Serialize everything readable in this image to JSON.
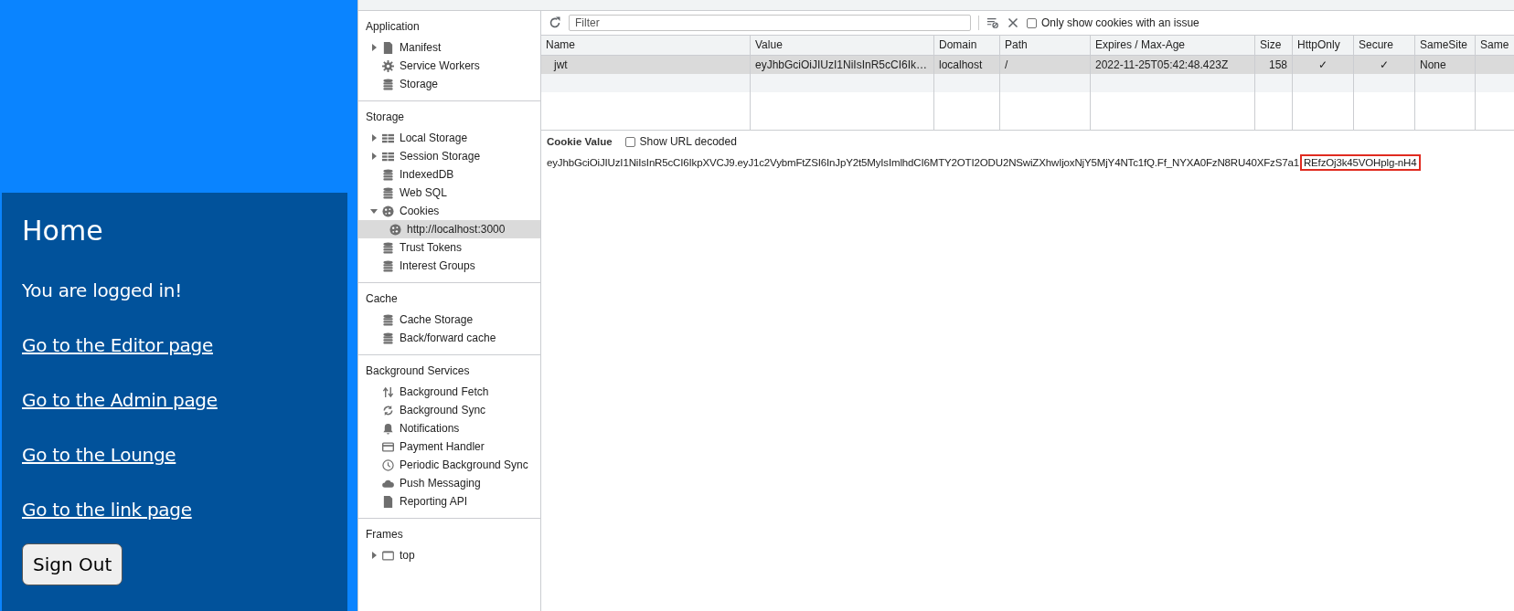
{
  "page": {
    "title": "Home",
    "message": "You are logged in!",
    "links": [
      {
        "label": "Go to the Editor page"
      },
      {
        "label": "Go to the Admin page"
      },
      {
        "label": "Go to the Lounge"
      },
      {
        "label": "Go to the link page"
      }
    ],
    "sign_out_button": "Sign Out"
  },
  "sidebar": {
    "sections": [
      {
        "title": "Application",
        "items": [
          {
            "label": "Manifest",
            "kind": "file",
            "expanded": false,
            "selected": false
          },
          {
            "label": "Service Workers",
            "kind": "gear",
            "selected": false
          },
          {
            "label": "Storage",
            "kind": "database",
            "selected": false
          }
        ]
      },
      {
        "title": "Storage",
        "items": [
          {
            "label": "Local Storage",
            "kind": "grid",
            "expanded": false,
            "selected": false
          },
          {
            "label": "Session Storage",
            "kind": "grid",
            "expanded": false,
            "selected": false
          },
          {
            "label": "IndexedDB",
            "kind": "database",
            "selected": false
          },
          {
            "label": "Web SQL",
            "kind": "database",
            "selected": false
          },
          {
            "label": "Cookies",
            "kind": "cookie",
            "expanded": true,
            "selected": false,
            "children": [
              {
                "label": "http://localhost:3000",
                "kind": "cookie",
                "selected": true
              }
            ]
          },
          {
            "label": "Trust Tokens",
            "kind": "database",
            "selected": false
          },
          {
            "label": "Interest Groups",
            "kind": "database",
            "selected": false
          }
        ]
      },
      {
        "title": "Cache",
        "items": [
          {
            "label": "Cache Storage",
            "kind": "database",
            "selected": false
          },
          {
            "label": "Back/forward cache",
            "kind": "database",
            "selected": false
          }
        ]
      },
      {
        "title": "Background Services",
        "items": [
          {
            "label": "Background Fetch",
            "kind": "updown",
            "selected": false
          },
          {
            "label": "Background Sync",
            "kind": "sync",
            "selected": false
          },
          {
            "label": "Notifications",
            "kind": "bell",
            "selected": false
          },
          {
            "label": "Payment Handler",
            "kind": "card",
            "selected": false
          },
          {
            "label": "Periodic Background Sync",
            "kind": "clock",
            "selected": false
          },
          {
            "label": "Push Messaging",
            "kind": "cloud",
            "selected": false
          },
          {
            "label": "Reporting API",
            "kind": "file",
            "selected": false
          }
        ]
      },
      {
        "title": "Frames",
        "items": [
          {
            "label": "top",
            "kind": "frame",
            "expanded": false,
            "selected": false
          }
        ]
      }
    ]
  },
  "toolbar": {
    "filter": {
      "placeholder": "Filter"
    },
    "only_issues_checkbox": {
      "label": "Only show cookies with an issue",
      "checked": false
    }
  },
  "table": {
    "columns": [
      "Name",
      "Value",
      "Domain",
      "Path",
      "Expires / Max-Age",
      "Size",
      "HttpOnly",
      "Secure",
      "SameSite",
      "Same"
    ],
    "rows": [
      {
        "selected": true,
        "cells": [
          "jwt",
          "eyJhbGciOiJIUzI1NiIsInR5cCI6Ik…",
          "localhost",
          "/",
          "2022-11-25T05:42:48.423Z",
          "158",
          "✓",
          "✓",
          "None",
          ""
        ]
      }
    ]
  },
  "cookie_value": {
    "title": "Cookie Value",
    "show_url_decoded": {
      "label": "Show URL decoded",
      "checked": false
    },
    "text": "eyJhbGciOiJIUzI1NiIsInR5cCI6IkpXVCJ9.eyJ1c2VybmFtZSI6InJpY2t5MyIsImlhdCI6MTY2OTI2ODU2NSwiZXhwIjoxNjY5MjY4NTc1fQ.Ff_NYXA0FzN8RU40XFzS7a1",
    "highlighted_text": "REfzOj3k45VOHplg-nH4"
  }
}
